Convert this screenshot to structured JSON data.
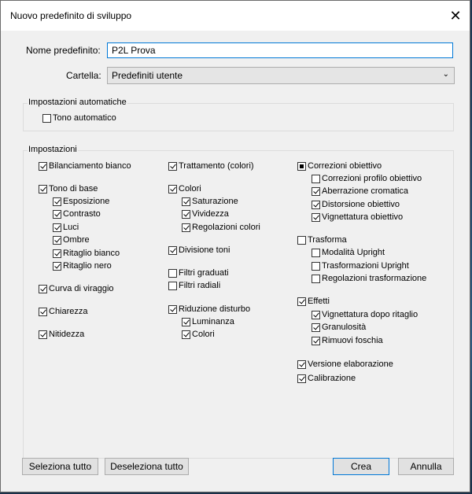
{
  "window": {
    "title": "Nuovo predefinito di sviluppo"
  },
  "form": {
    "name_label": "Nome predefinito:",
    "name_value": "P2L Prova",
    "folder_label": "Cartella:",
    "folder_value": "Predefiniti utente"
  },
  "auto": {
    "title": "Impostazioni automatiche",
    "tono": {
      "label": "Tono automatico",
      "checked": false
    }
  },
  "settings": {
    "title": "Impostazioni",
    "col1": [
      {
        "label": "Bilanciamento bianco",
        "state": "checked"
      },
      {
        "label": "Tono di base",
        "state": "checked"
      },
      {
        "label": "Esposizione",
        "state": "checked"
      },
      {
        "label": "Contrasto",
        "state": "checked"
      },
      {
        "label": "Luci",
        "state": "checked"
      },
      {
        "label": "Ombre",
        "state": "checked"
      },
      {
        "label": "Ritaglio bianco",
        "state": "checked"
      },
      {
        "label": "Ritaglio nero",
        "state": "checked"
      },
      {
        "label": "Curva di viraggio",
        "state": "checked"
      },
      {
        "label": "Chiarezza",
        "state": "checked"
      },
      {
        "label": "Nitidezza",
        "state": "checked"
      }
    ],
    "col2": [
      {
        "label": "Trattamento (colori)",
        "state": "checked"
      },
      {
        "label": "Colori",
        "state": "checked"
      },
      {
        "label": "Saturazione",
        "state": "checked"
      },
      {
        "label": "Vividezza",
        "state": "checked"
      },
      {
        "label": "Regolazioni colori",
        "state": "checked"
      },
      {
        "label": "Divisione toni",
        "state": "checked"
      },
      {
        "label": "Filtri graduati",
        "state": "unchecked"
      },
      {
        "label": "Filtri radiali",
        "state": "unchecked"
      },
      {
        "label": "Riduzione disturbo",
        "state": "checked"
      },
      {
        "label": "Luminanza",
        "state": "checked"
      },
      {
        "label": "Colori",
        "state": "checked"
      }
    ],
    "col3": [
      {
        "label": "Correzioni obiettivo",
        "state": "partial"
      },
      {
        "label": "Correzioni profilo obiettivo",
        "state": "unchecked"
      },
      {
        "label": "Aberrazione cromatica",
        "state": "checked"
      },
      {
        "label": "Distorsione obiettivo",
        "state": "checked"
      },
      {
        "label": "Vignettatura obiettivo",
        "state": "checked"
      },
      {
        "label": "Trasforma",
        "state": "unchecked"
      },
      {
        "label": "Modalità Upright",
        "state": "unchecked"
      },
      {
        "label": "Trasformazioni Upright",
        "state": "unchecked"
      },
      {
        "label": "Regolazioni trasformazione",
        "state": "unchecked"
      },
      {
        "label": "Effetti",
        "state": "checked"
      },
      {
        "label": "Vignettatura dopo ritaglio",
        "state": "checked"
      },
      {
        "label": "Granulosità",
        "state": "checked"
      },
      {
        "label": "Rimuovi foschia",
        "state": "checked"
      },
      {
        "label": "Versione elaborazione",
        "state": "checked"
      },
      {
        "label": "Calibrazione",
        "state": "checked"
      }
    ]
  },
  "buttons": {
    "select_all": "Seleziona tutto",
    "deselect_all": "Deseleziona tutto",
    "create": "Crea",
    "cancel": "Annulla"
  },
  "icons": {
    "close": "close-icon",
    "dropdown": "chevron-down-icon"
  }
}
